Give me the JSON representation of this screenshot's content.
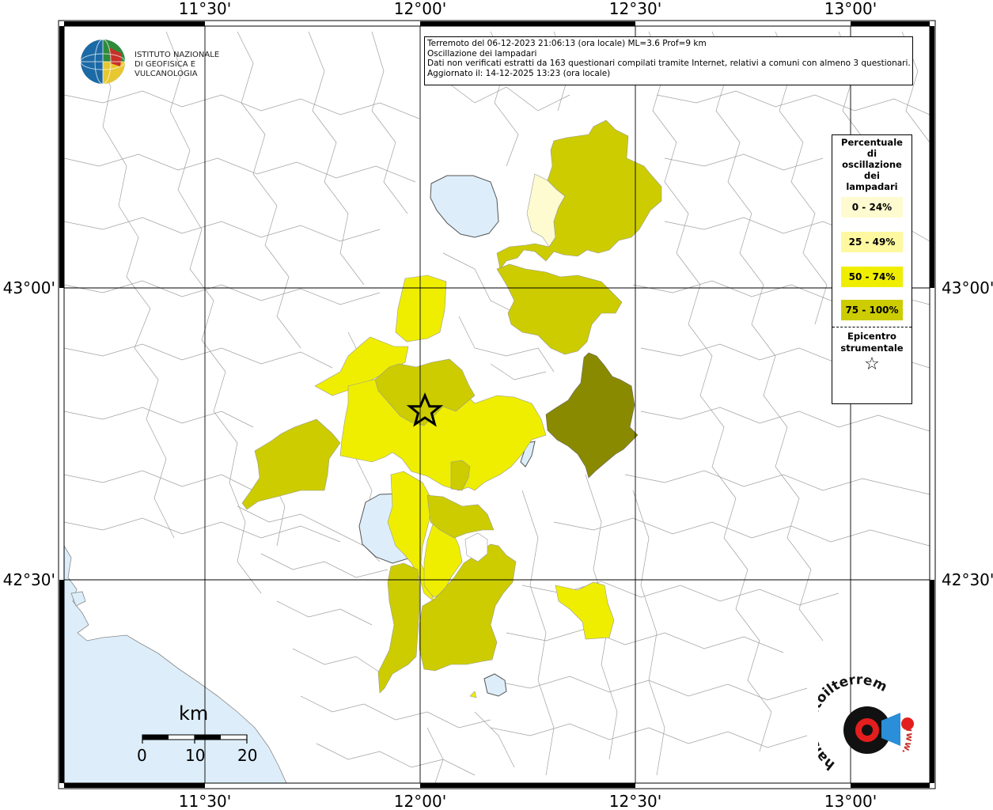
{
  "header": {
    "line1": "Terremoto del 06-12-2023 21:06:13 (ora locale) ML=3.6 Prof=9 km",
    "line2": "Oscillazione dei lampadari",
    "line3": "Dati non verificati estratti da 163 questionari compilati tramite Internet, relativi a comuni con almeno 3 questionari.",
    "line4": "Aggiornato il: 14-12-2025 13:23 (ora locale)"
  },
  "institute": {
    "line1": "ISTITUTO NAZIONALE",
    "line2": "DI GEOFISICA E VULCANOLOGIA"
  },
  "axes": {
    "lon_ticks": [
      "11°30'",
      "12°00'",
      "12°30'",
      "13°00'"
    ],
    "lat_ticks": [
      "43°00'",
      "42°30'"
    ]
  },
  "legend": {
    "title_lines": [
      "Percentuale",
      "di",
      "oscillazione",
      "dei",
      "lampadari"
    ],
    "items": [
      {
        "label": "0 - 24%",
        "color": "#fefbd0"
      },
      {
        "label": "25 - 49%",
        "color": "#fef8a0"
      },
      {
        "label": "50 - 74%",
        "color": "#efee00"
      },
      {
        "label": "75 - 100%",
        "color": "#cccc00"
      }
    ],
    "epicenter_lines": [
      "Epicentro",
      "strumentale"
    ],
    "epicenter_symbol": "☆"
  },
  "scale": {
    "unit": "km",
    "labels": [
      "0",
      "10",
      "20"
    ]
  },
  "colors": {
    "water": "#ddeefa",
    "dark_olive": "#8a8a00"
  },
  "watermark": {
    "text_left": "haisentitoilterremoto.it",
    "text_right": "www."
  }
}
